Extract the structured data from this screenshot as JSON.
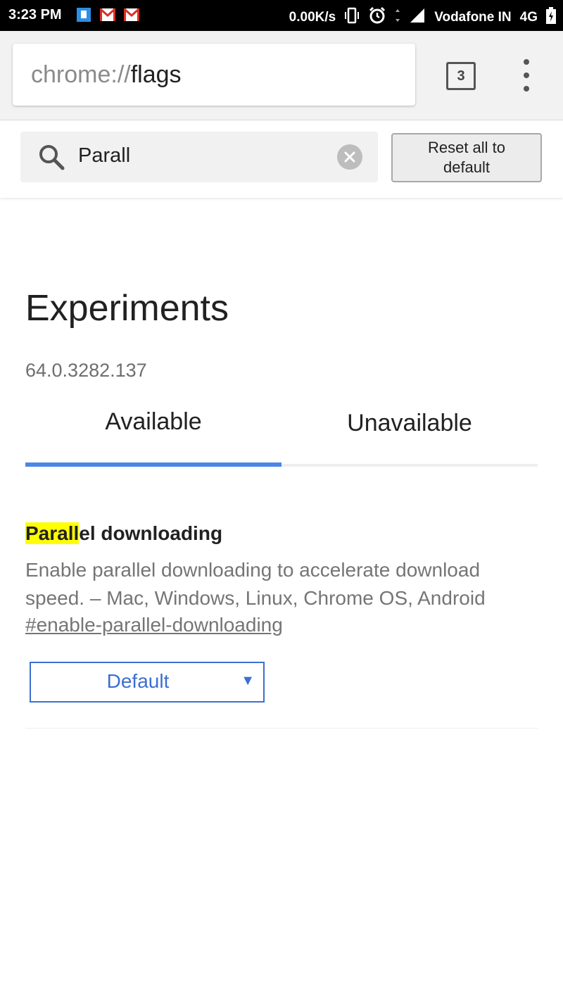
{
  "status_bar": {
    "time": "3:23 PM",
    "net_speed": "0.00K/s",
    "carrier": "Vodafone IN",
    "network_type": "4G",
    "notification_icons": [
      "message-icon",
      "gmail-icon",
      "gmail-icon"
    ]
  },
  "toolbar": {
    "url_scheme": "chrome://",
    "url_host": "flags",
    "tab_count": "3"
  },
  "search": {
    "query": "Parall"
  },
  "reset_button": {
    "label": "Reset all to default"
  },
  "main": {
    "title": "Experiments",
    "version": "64.0.3282.137",
    "tabs": [
      {
        "label": "Available",
        "selected": true
      },
      {
        "label": "Unavailable",
        "selected": false
      }
    ]
  },
  "experiments": [
    {
      "title_highlight": "Parall",
      "title_rest": "el downloading",
      "description": "Enable parallel downloading to accelerate download speed. – Mac, Windows, Linux, Chrome OS, Android",
      "permalink": "#enable-parallel-downloading",
      "selected_option": "Default"
    }
  ],
  "colors": {
    "accent": "#4a86e8",
    "highlight": "#ffff00",
    "select_blue": "#3c6fd1"
  }
}
